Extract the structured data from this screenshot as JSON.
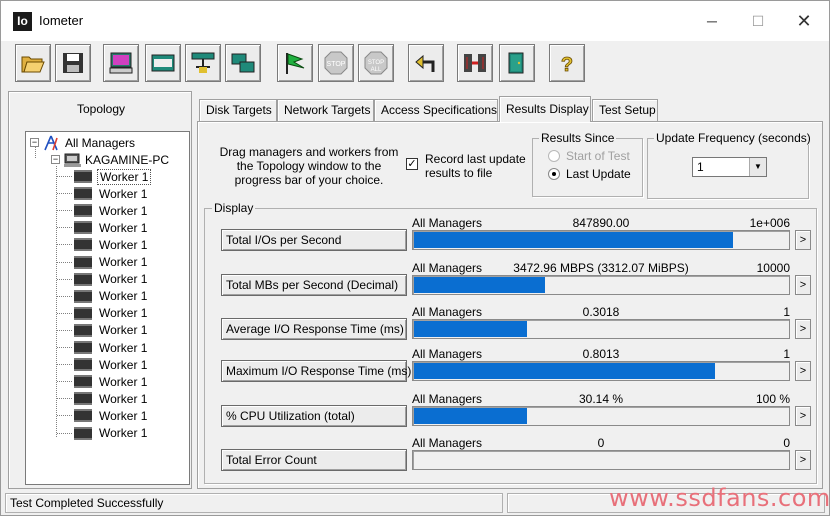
{
  "window": {
    "title": "Iometer",
    "logo_text": "Io",
    "controls": [
      "─",
      "☐",
      "✕"
    ]
  },
  "toolbar": {
    "buttons": [
      {
        "name": "open-config",
        "icon": "folder-open-icon"
      },
      {
        "name": "save-config",
        "icon": "floppy-disk-icon"
      },
      {
        "name": "start-disk-worker",
        "icon": "monitor-icon"
      },
      {
        "name": "start-network-worker",
        "icon": "disk-worker-icon"
      },
      {
        "name": "add-manager",
        "icon": "network-worker-icon"
      },
      {
        "name": "copy-worker",
        "icon": "duplicate-worker-icon"
      },
      {
        "name": "start-tests",
        "icon": "green-flag-icon"
      },
      {
        "name": "stop-current",
        "icon": "stop-sign-icon"
      },
      {
        "name": "stop-all",
        "icon": "stop-all-icon"
      },
      {
        "name": "reset-workers",
        "icon": "undo-arrow-icon"
      },
      {
        "name": "exit",
        "icon": "disconnect-icon"
      },
      {
        "name": "exit-door",
        "icon": "exit-door-icon"
      },
      {
        "name": "about",
        "icon": "question-mark-icon"
      }
    ],
    "stop_label": "STOP",
    "stop_all_label": "STOP ALL"
  },
  "topology": {
    "title": "Topology",
    "root": "All Managers",
    "manager": "KAGAMINE-PC",
    "workers": [
      "Worker 1",
      "Worker 1",
      "Worker 1",
      "Worker 1",
      "Worker 1",
      "Worker 1",
      "Worker 1",
      "Worker 1",
      "Worker 1",
      "Worker 1",
      "Worker 1",
      "Worker 1",
      "Worker 1",
      "Worker 1",
      "Worker 1",
      "Worker 1"
    ]
  },
  "tabs": [
    {
      "label": "Disk Targets"
    },
    {
      "label": "Network Targets"
    },
    {
      "label": "Access Specifications"
    },
    {
      "label": "Results Display"
    },
    {
      "label": "Test Setup"
    }
  ],
  "results": {
    "drag_text": "Drag managers and workers from the Topology window to the progress bar of your choice.",
    "record_label": "Record last update results to file",
    "record_checked": true,
    "results_since": {
      "legend": "Results Since",
      "option_start": "Start of Test",
      "option_last": "Last Update",
      "selected": "Last Update"
    },
    "update_frequency": {
      "legend": "Update Frequency (seconds)",
      "value": "1"
    },
    "display_legend": "Display"
  },
  "metrics": [
    {
      "button": "Total I/Os per Second",
      "target": "All Managers",
      "value": "847890.00",
      "max": "1e+006",
      "fill": 0.8479
    },
    {
      "button": "Total MBs per Second (Decimal)",
      "target": "All Managers",
      "value": "3472.96 MBPS (3312.07 MiBPS)",
      "max": "10000",
      "fill": 0.3473
    },
    {
      "button": "Average I/O Response Time (ms)",
      "target": "All Managers",
      "value": "0.3018",
      "max": "1",
      "fill": 0.3018
    },
    {
      "button": "Maximum I/O Response Time (ms)",
      "target": "All Managers",
      "value": "0.8013",
      "max": "1",
      "fill": 0.8013
    },
    {
      "button": "% CPU Utilization (total)",
      "target": "All Managers",
      "value": "30.14 %",
      "max": "100 %",
      "fill": 0.3014
    },
    {
      "button": "Total Error Count",
      "target": "All Managers",
      "value": "0",
      "max": "0",
      "fill": 0
    }
  ],
  "colors": {
    "bar": "#0a6ed1",
    "watermark": "#e8707a"
  },
  "status": {
    "message": "Test Completed Successfully",
    "watermark": "www.ssdfans.com"
  }
}
